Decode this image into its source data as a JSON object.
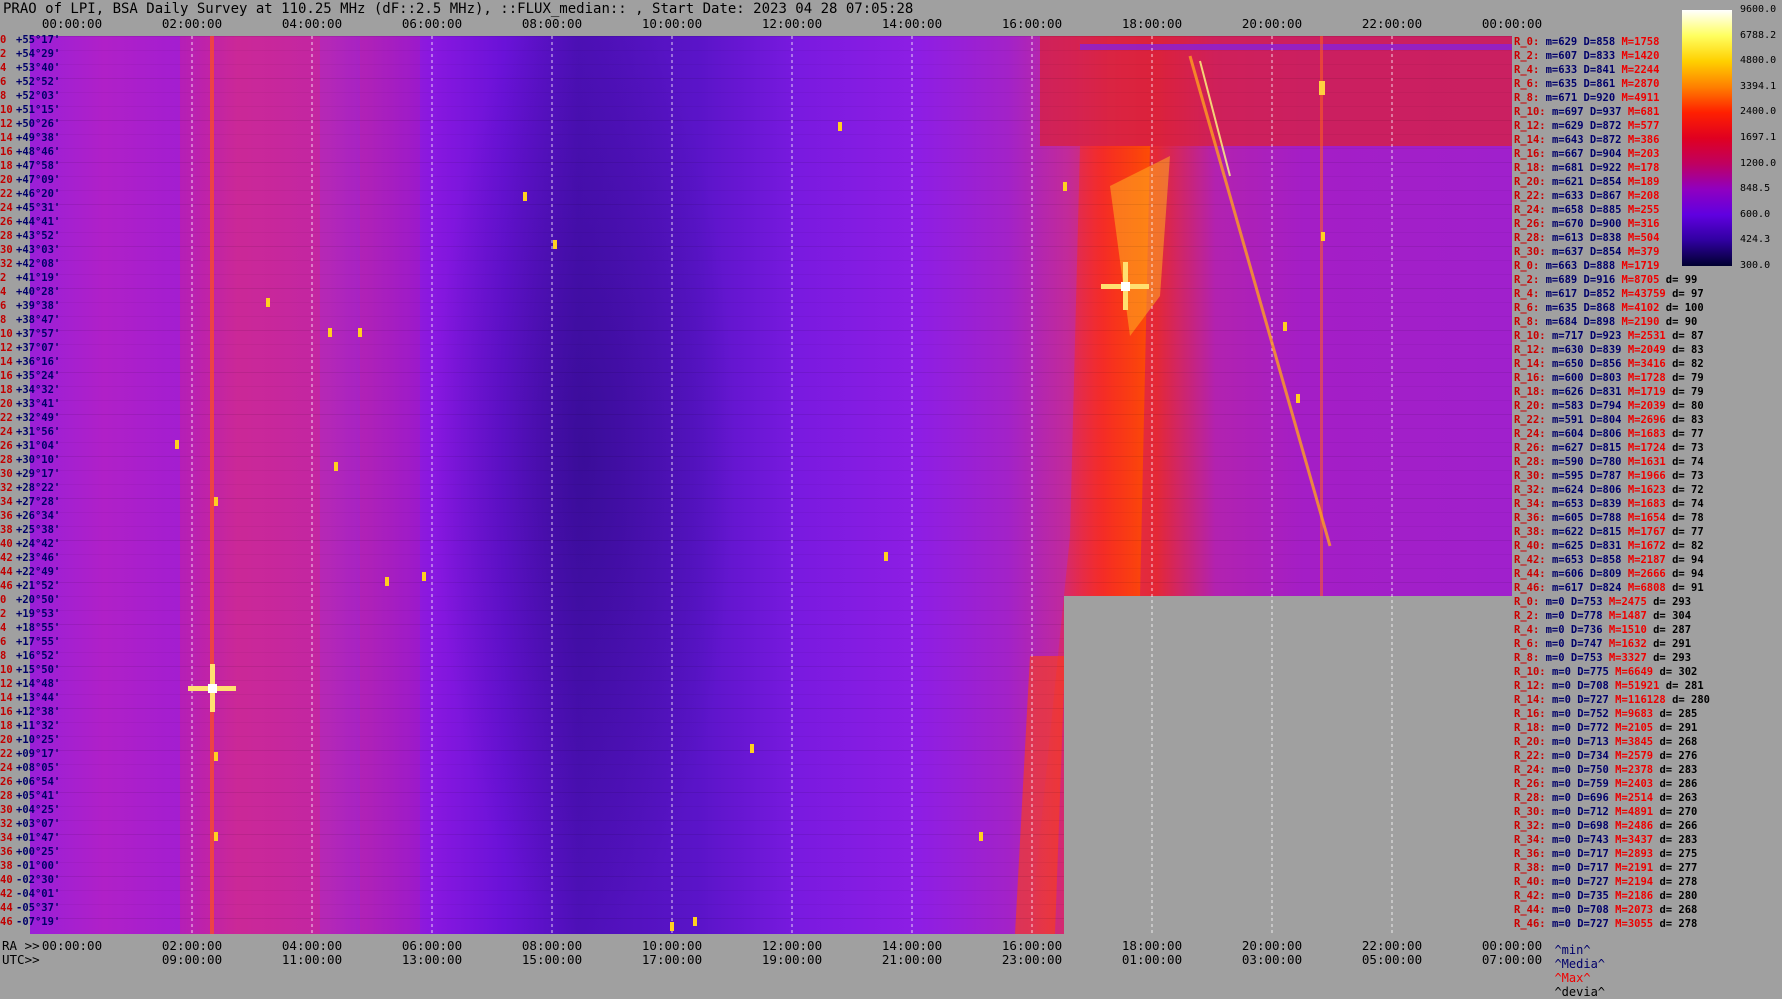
{
  "header": {
    "title": "PRAO of LPI, BSA Daily Survey at 110.25 MHz (dF::2.5 MHz), ::FLUX_median:: , Start Date: 2023 04 28 07:05:28"
  },
  "axes": {
    "top_ticks": [
      "00:00:00",
      "02:00:00",
      "04:00:00",
      "06:00:00",
      "08:00:00",
      "10:00:00",
      "12:00:00",
      "14:00:00",
      "16:00:00",
      "18:00:00",
      "20:00:00",
      "22:00:00",
      "00:00:00"
    ],
    "bottom_ra_prefix": "RA >>",
    "bottom_ra_ticks": [
      "00:00:00",
      "02:00:00",
      "04:00:00",
      "06:00:00",
      "08:00:00",
      "10:00:00",
      "12:00:00",
      "14:00:00",
      "16:00:00",
      "18:00:00",
      "20:00:00",
      "22:00:00",
      "00:00:00"
    ],
    "bottom_utc_prefix": "UTC>>",
    "bottom_utc_ticks": [
      "09:00:00",
      "11:00:00",
      "13:00:00",
      "15:00:00",
      "17:00:00",
      "19:00:00",
      "21:00:00",
      "23:00:00",
      "01:00:00",
      "03:00:00",
      "05:00:00",
      "07:00:00"
    ]
  },
  "declinations": [
    {
      "idx": "0",
      "dec": "+55°17'"
    },
    {
      "idx": "2",
      "dec": "+54°29'"
    },
    {
      "idx": "4",
      "dec": "+53°40'"
    },
    {
      "idx": "6",
      "dec": "+52°52'"
    },
    {
      "idx": "8",
      "dec": "+52°03'"
    },
    {
      "idx": "10",
      "dec": "+51°15'"
    },
    {
      "idx": "12",
      "dec": "+50°26'"
    },
    {
      "idx": "14",
      "dec": "+49°38'"
    },
    {
      "idx": "16",
      "dec": "+48°46'"
    },
    {
      "idx": "18",
      "dec": "+47°58'"
    },
    {
      "idx": "20",
      "dec": "+47°09'"
    },
    {
      "idx": "22",
      "dec": "+46°20'"
    },
    {
      "idx": "24",
      "dec": "+45°31'"
    },
    {
      "idx": "26",
      "dec": "+44°41'"
    },
    {
      "idx": "28",
      "dec": "+43°52'"
    },
    {
      "idx": "30",
      "dec": "+43°03'"
    },
    {
      "idx": "32",
      "dec": "+42°08'"
    },
    {
      "idx": "2",
      "dec": "+41°19'"
    },
    {
      "idx": "4",
      "dec": "+40°28'"
    },
    {
      "idx": "6",
      "dec": "+39°38'"
    },
    {
      "idx": "8",
      "dec": "+38°47'"
    },
    {
      "idx": "10",
      "dec": "+37°57'"
    },
    {
      "idx": "12",
      "dec": "+37°07'"
    },
    {
      "idx": "14",
      "dec": "+36°16'"
    },
    {
      "idx": "16",
      "dec": "+35°24'"
    },
    {
      "idx": "18",
      "dec": "+34°32'"
    },
    {
      "idx": "20",
      "dec": "+33°41'"
    },
    {
      "idx": "22",
      "dec": "+32°49'"
    },
    {
      "idx": "24",
      "dec": "+31°56'"
    },
    {
      "idx": "26",
      "dec": "+31°04'"
    },
    {
      "idx": "28",
      "dec": "+30°10'"
    },
    {
      "idx": "30",
      "dec": "+29°17'"
    },
    {
      "idx": "32",
      "dec": "+28°22'"
    },
    {
      "idx": "34",
      "dec": "+27°28'"
    },
    {
      "idx": "36",
      "dec": "+26°34'"
    },
    {
      "idx": "38",
      "dec": "+25°38'"
    },
    {
      "idx": "40",
      "dec": "+24°42'"
    },
    {
      "idx": "42",
      "dec": "+23°46'"
    },
    {
      "idx": "44",
      "dec": "+22°49'"
    },
    {
      "idx": "46",
      "dec": "+21°52'"
    },
    {
      "idx": "0",
      "dec": "+20°50'"
    },
    {
      "idx": "2",
      "dec": "+19°53'"
    },
    {
      "idx": "4",
      "dec": "+18°55'"
    },
    {
      "idx": "6",
      "dec": "+17°55'"
    },
    {
      "idx": "8",
      "dec": "+16°52'"
    },
    {
      "idx": "10",
      "dec": "+15°50'"
    },
    {
      "idx": "12",
      "dec": "+14°48'"
    },
    {
      "idx": "14",
      "dec": "+13°44'"
    },
    {
      "idx": "16",
      "dec": "+12°38'"
    },
    {
      "idx": "18",
      "dec": "+11°32'"
    },
    {
      "idx": "20",
      "dec": "+10°25'"
    },
    {
      "idx": "22",
      "dec": "+09°17'"
    },
    {
      "idx": "24",
      "dec": "+08°05'"
    },
    {
      "idx": "26",
      "dec": "+06°54'"
    },
    {
      "idx": "28",
      "dec": "+05°41'"
    },
    {
      "idx": "30",
      "dec": "+04°25'"
    },
    {
      "idx": "32",
      "dec": "+03°07'"
    },
    {
      "idx": "34",
      "dec": "+01°47'"
    },
    {
      "idx": "36",
      "dec": "+00°25'"
    },
    {
      "idx": "38",
      "dec": "-01°00'"
    },
    {
      "idx": "40",
      "dec": "-02°30'"
    },
    {
      "idx": "42",
      "dec": "-04°01'"
    },
    {
      "idx": "44",
      "dec": "-05°37'"
    },
    {
      "idx": "46",
      "dec": "-07°19'"
    }
  ],
  "stats": [
    {
      "r": "R_0:",
      "min": "m=629",
      "med": "D=858",
      "max": "M=1758",
      "dev": ""
    },
    {
      "r": "R_2:",
      "min": "m=607",
      "med": "D=833",
      "max": "M=1420",
      "dev": ""
    },
    {
      "r": "R_4:",
      "min": "m=633",
      "med": "D=841",
      "max": "M=2244",
      "dev": ""
    },
    {
      "r": "R_6:",
      "min": "m=635",
      "med": "D=861",
      "max": "M=2870",
      "dev": ""
    },
    {
      "r": "R_8:",
      "min": "m=671",
      "med": "D=920",
      "max": "M=4911",
      "dev": ""
    },
    {
      "r": "R_10:",
      "min": "m=697",
      "med": "D=937",
      "max": "M=681",
      "dev": ""
    },
    {
      "r": "R_12:",
      "min": "m=629",
      "med": "D=872",
      "max": "M=577",
      "dev": ""
    },
    {
      "r": "R_14:",
      "min": "m=643",
      "med": "D=872",
      "max": "M=386",
      "dev": ""
    },
    {
      "r": "R_16:",
      "min": "m=667",
      "med": "D=904",
      "max": "M=203",
      "dev": ""
    },
    {
      "r": "R_18:",
      "min": "m=681",
      "med": "D=922",
      "max": "M=178",
      "dev": ""
    },
    {
      "r": "R_20:",
      "min": "m=621",
      "med": "D=854",
      "max": "M=189",
      "dev": ""
    },
    {
      "r": "R_22:",
      "min": "m=633",
      "med": "D=867",
      "max": "M=208",
      "dev": ""
    },
    {
      "r": "R_24:",
      "min": "m=658",
      "med": "D=885",
      "max": "M=255",
      "dev": ""
    },
    {
      "r": "R_26:",
      "min": "m=670",
      "med": "D=900",
      "max": "M=316",
      "dev": ""
    },
    {
      "r": "R_28:",
      "min": "m=613",
      "med": "D=838",
      "max": "M=504",
      "dev": ""
    },
    {
      "r": "R_30:",
      "min": "m=637",
      "med": "D=854",
      "max": "M=379",
      "dev": ""
    },
    {
      "r": "R_0:",
      "min": "m=663",
      "med": "D=888",
      "max": "M=1719",
      "dev": ""
    },
    {
      "r": "R_2:",
      "min": "m=689",
      "med": "D=916",
      "max": "M=8705",
      "dev": "d= 99"
    },
    {
      "r": "R_4:",
      "min": "m=617",
      "med": "D=852",
      "max": "M=43759",
      "dev": "d= 97"
    },
    {
      "r": "R_6:",
      "min": "m=635",
      "med": "D=868",
      "max": "M=4102",
      "dev": "d= 100"
    },
    {
      "r": "R_8:",
      "min": "m=684",
      "med": "D=898",
      "max": "M=2190",
      "dev": "d= 90"
    },
    {
      "r": "R_10:",
      "min": "m=717",
      "med": "D=923",
      "max": "M=2531",
      "dev": "d= 87"
    },
    {
      "r": "R_12:",
      "min": "m=630",
      "med": "D=839",
      "max": "M=2049",
      "dev": "d= 83"
    },
    {
      "r": "R_14:",
      "min": "m=650",
      "med": "D=856",
      "max": "M=3416",
      "dev": "d= 82"
    },
    {
      "r": "R_16:",
      "min": "m=600",
      "med": "D=803",
      "max": "M=1728",
      "dev": "d= 79"
    },
    {
      "r": "R_18:",
      "min": "m=626",
      "med": "D=831",
      "max": "M=1719",
      "dev": "d= 79"
    },
    {
      "r": "R_20:",
      "min": "m=583",
      "med": "D=794",
      "max": "M=2039",
      "dev": "d= 80"
    },
    {
      "r": "R_22:",
      "min": "m=591",
      "med": "D=804",
      "max": "M=2696",
      "dev": "d= 83"
    },
    {
      "r": "R_24:",
      "min": "m=604",
      "med": "D=806",
      "max": "M=1683",
      "dev": "d= 77"
    },
    {
      "r": "R_26:",
      "min": "m=627",
      "med": "D=815",
      "max": "M=1724",
      "dev": "d= 73"
    },
    {
      "r": "R_28:",
      "min": "m=590",
      "med": "D=780",
      "max": "M=1631",
      "dev": "d= 74"
    },
    {
      "r": "R_30:",
      "min": "m=595",
      "med": "D=787",
      "max": "M=1966",
      "dev": "d= 73"
    },
    {
      "r": "R_32:",
      "min": "m=624",
      "med": "D=806",
      "max": "M=1623",
      "dev": "d= 72"
    },
    {
      "r": "R_34:",
      "min": "m=653",
      "med": "D=839",
      "max": "M=1683",
      "dev": "d= 74"
    },
    {
      "r": "R_36:",
      "min": "m=605",
      "med": "D=788",
      "max": "M=1654",
      "dev": "d= 78"
    },
    {
      "r": "R_38:",
      "min": "m=622",
      "med": "D=815",
      "max": "M=1767",
      "dev": "d= 77"
    },
    {
      "r": "R_40:",
      "min": "m=625",
      "med": "D=831",
      "max": "M=1672",
      "dev": "d= 82"
    },
    {
      "r": "R_42:",
      "min": "m=653",
      "med": "D=858",
      "max": "M=2187",
      "dev": "d= 94"
    },
    {
      "r": "R_44:",
      "min": "m=606",
      "med": "D=809",
      "max": "M=2666",
      "dev": "d= 94"
    },
    {
      "r": "R_46:",
      "min": "m=617",
      "med": "D=824",
      "max": "M=6808",
      "dev": "d= 91"
    },
    {
      "r": "R_0:",
      "min": "m=0",
      "med": "D=753",
      "max": "M=2475",
      "dev": "d= 293"
    },
    {
      "r": "R_2:",
      "min": "m=0",
      "med": "D=778",
      "max": "M=1487",
      "dev": "d= 304"
    },
    {
      "r": "R_4:",
      "min": "m=0",
      "med": "D=736",
      "max": "M=1510",
      "dev": "d= 287"
    },
    {
      "r": "R_6:",
      "min": "m=0",
      "med": "D=747",
      "max": "M=1632",
      "dev": "d= 291"
    },
    {
      "r": "R_8:",
      "min": "m=0",
      "med": "D=753",
      "max": "M=3327",
      "dev": "d= 293"
    },
    {
      "r": "R_10:",
      "min": "m=0",
      "med": "D=775",
      "max": "M=6649",
      "dev": "d= 302"
    },
    {
      "r": "R_12:",
      "min": "m=0",
      "med": "D=708",
      "max": "M=51921",
      "dev": "d= 281"
    },
    {
      "r": "R_14:",
      "min": "m=0",
      "med": "D=727",
      "max": "M=116128",
      "dev": "d= 280"
    },
    {
      "r": "R_16:",
      "min": "m=0",
      "med": "D=752",
      "max": "M=9683",
      "dev": "d= 285"
    },
    {
      "r": "R_18:",
      "min": "m=0",
      "med": "D=772",
      "max": "M=2105",
      "dev": "d= 291"
    },
    {
      "r": "R_20:",
      "min": "m=0",
      "med": "D=713",
      "max": "M=3845",
      "dev": "d= 268"
    },
    {
      "r": "R_22:",
      "min": "m=0",
      "med": "D=734",
      "max": "M=2579",
      "dev": "d= 276"
    },
    {
      "r": "R_24:",
      "min": "m=0",
      "med": "D=750",
      "max": "M=2378",
      "dev": "d= 283"
    },
    {
      "r": "R_26:",
      "min": "m=0",
      "med": "D=759",
      "max": "M=2403",
      "dev": "d= 286"
    },
    {
      "r": "R_28:",
      "min": "m=0",
      "med": "D=696",
      "max": "M=2514",
      "dev": "d= 263"
    },
    {
      "r": "R_30:",
      "min": "m=0",
      "med": "D=712",
      "max": "M=4891",
      "dev": "d= 270"
    },
    {
      "r": "R_32:",
      "min": "m=0",
      "med": "D=698",
      "max": "M=2486",
      "dev": "d= 266"
    },
    {
      "r": "R_34:",
      "min": "m=0",
      "med": "D=743",
      "max": "M=3437",
      "dev": "d= 283"
    },
    {
      "r": "R_36:",
      "min": "m=0",
      "med": "D=717",
      "max": "M=2893",
      "dev": "d= 275"
    },
    {
      "r": "R_38:",
      "min": "m=0",
      "med": "D=717",
      "max": "M=2191",
      "dev": "d= 277"
    },
    {
      "r": "R_40:",
      "min": "m=0",
      "med": "D=727",
      "max": "M=2194",
      "dev": "d= 278"
    },
    {
      "r": "R_42:",
      "min": "m=0",
      "med": "D=735",
      "max": "M=2186",
      "dev": "d= 280"
    },
    {
      "r": "R_44:",
      "min": "m=0",
      "med": "D=708",
      "max": "M=2073",
      "dev": "d= 268"
    },
    {
      "r": "R_46:",
      "min": "m=0",
      "med": "D=727",
      "max": "M=3055",
      "dev": "d= 278"
    }
  ],
  "stats_legend": {
    "min": "^min^",
    "med": "^Media^",
    "max": "^Max^",
    "dev": "^devia^"
  },
  "colorbar": {
    "labels": [
      "9600.0",
      "6788.2",
      "4800.0",
      "3394.1",
      "2400.0",
      "1697.1",
      "1200.0",
      "848.5",
      "600.0",
      "424.3",
      "300.0"
    ],
    "colors": [
      "#ffffff",
      "#ffff60",
      "#ffd000",
      "#ff8000",
      "#ff2000",
      "#e00020",
      "#c00060",
      "#9000c0",
      "#6000e0",
      "#3000a0",
      "#000030"
    ]
  },
  "chart_data": {
    "type": "heatmap",
    "title": "PRAO of LPI, BSA Daily Survey at 110.25 MHz (dF::2.5 MHz), ::FLUX_median:: , Start Date: 2023 04 28 07:05:28",
    "x_axis": "RA 00:00:00 – 24:00:00 (2h ticks)",
    "y_axis": "Declination, beams 0–46, +55°17' to -07°19'",
    "scale": "logarithmic",
    "zlim": [
      300,
      9600
    ],
    "bright_sources": [
      {
        "ra_h": 2.3,
        "beam_dec": "+14°48'",
        "flux": "high"
      },
      {
        "ra_h": 20.0,
        "beam_dec": "+41°19'",
        "flux": "high"
      },
      {
        "ra_h": 23.3,
        "beam_dec": "+52°52'",
        "flux": "medium"
      }
    ],
    "missing_region": {
      "ra_from_h": 19.0,
      "ra_to_h": 24.0,
      "dec_below": "+21°52'"
    }
  }
}
